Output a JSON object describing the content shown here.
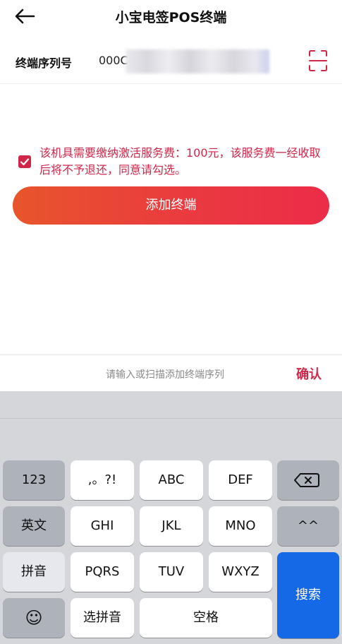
{
  "header": {
    "title": "小宝电签POS终端",
    "back_icon": "back-arrow-icon"
  },
  "serial": {
    "label": "终端序列号",
    "value": "000C",
    "scan_icon": "scan-icon"
  },
  "agreement": {
    "checked": true,
    "text": "该机具需要缴纳激活服务费：100元，该服务费一经收取后将不予退还，同意请勾选。"
  },
  "add_button": {
    "label": "添加终端"
  },
  "input_bar": {
    "placeholder": "请输入或扫描添加终端序列",
    "confirm_label": "确认"
  },
  "keyboard": {
    "rows": [
      [
        "123",
        ",。?!",
        "ABC",
        "DEF",
        "⌫"
      ],
      [
        "英文",
        "GHI",
        "JKL",
        "MNO",
        "^^"
      ],
      [
        "拼音",
        "PQRS",
        "TUV",
        "WXYZ",
        "搜索"
      ],
      [
        "☺",
        "选拼音",
        "空格"
      ]
    ]
  },
  "colors": {
    "accent": "#d02749",
    "button_gradient_start": "#e8552b",
    "button_gradient_end": "#ec2c48",
    "search_key": "#1669e6"
  }
}
